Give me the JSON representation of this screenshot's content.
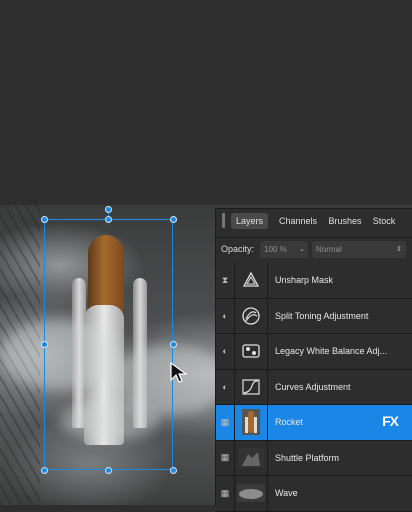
{
  "panel": {
    "tabs": [
      {
        "label": "Layers",
        "active": true
      },
      {
        "label": "Channels",
        "active": false
      },
      {
        "label": "Brushes",
        "active": false
      },
      {
        "label": "Stock",
        "active": false
      }
    ],
    "opacity_label": "Opacity:",
    "opacity_value": "100 %",
    "blend_mode": "Normal"
  },
  "layers": [
    {
      "name": "Unsharp Mask",
      "icon": "unsharp-mask-icon"
    },
    {
      "name": "Split Toning Adjustment",
      "icon": "split-toning-icon"
    },
    {
      "name": "Legacy White Balance Adj...",
      "icon": "white-balance-icon"
    },
    {
      "name": "Curves Adjustment",
      "icon": "curves-icon"
    },
    {
      "name": "Rocket",
      "icon": "rocket-thumbnail",
      "selected": true,
      "badge": "FX"
    },
    {
      "name": "Shuttle Platform",
      "icon": "platform-thumbnail"
    },
    {
      "name": "Wave",
      "icon": "wave-thumbnail"
    }
  ],
  "colors": {
    "accent": "#1a86e6",
    "selection": "#1e88e5",
    "panel_bg": "#2d2d2d"
  }
}
